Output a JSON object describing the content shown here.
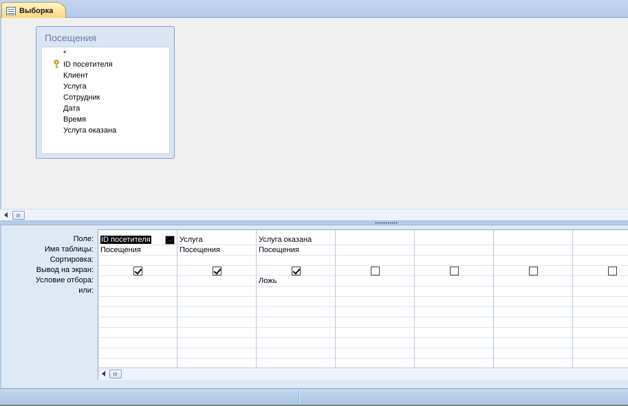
{
  "tab": {
    "label": "Выборка",
    "icon": "query-icon"
  },
  "table_box": {
    "title": "Посещения",
    "fields": [
      {
        "label": "*",
        "key": false
      },
      {
        "label": "ID посетителя",
        "key": true
      },
      {
        "label": "Клиент",
        "key": false
      },
      {
        "label": "Услуга",
        "key": false
      },
      {
        "label": "Сотрудник",
        "key": false
      },
      {
        "label": "Дата",
        "key": false
      },
      {
        "label": "Время",
        "key": false
      },
      {
        "label": "Услуга оказана",
        "key": false
      }
    ]
  },
  "grid": {
    "row_headers": [
      "Поле:",
      "Имя таблицы:",
      "Сортировка:",
      "Вывод на экран:",
      "Условие отбора:",
      "или:"
    ],
    "columns": [
      {
        "field": "ID посетителя",
        "table": "Посещения",
        "sort": "",
        "show": true,
        "criteria": "",
        "or": "",
        "selected": true
      },
      {
        "field": "Услуга",
        "table": "Посещения",
        "sort": "",
        "show": true,
        "criteria": "",
        "or": ""
      },
      {
        "field": "Услуга оказана",
        "table": "Посещения",
        "sort": "",
        "show": true,
        "criteria": "Ложь",
        "or": ""
      },
      {
        "field": "",
        "table": "",
        "sort": "",
        "show": false,
        "criteria": "",
        "or": ""
      },
      {
        "field": "",
        "table": "",
        "sort": "",
        "show": false,
        "criteria": "",
        "or": ""
      },
      {
        "field": "",
        "table": "",
        "sort": "",
        "show": false,
        "criteria": "",
        "or": ""
      },
      {
        "field": "",
        "table": "",
        "sort": "",
        "show": false,
        "criteria": "",
        "or": ""
      }
    ]
  },
  "colors": {
    "tab_active": "#ffd77a",
    "chrome_blue": "#b3cae9",
    "grid_line": "#b9c9df"
  }
}
